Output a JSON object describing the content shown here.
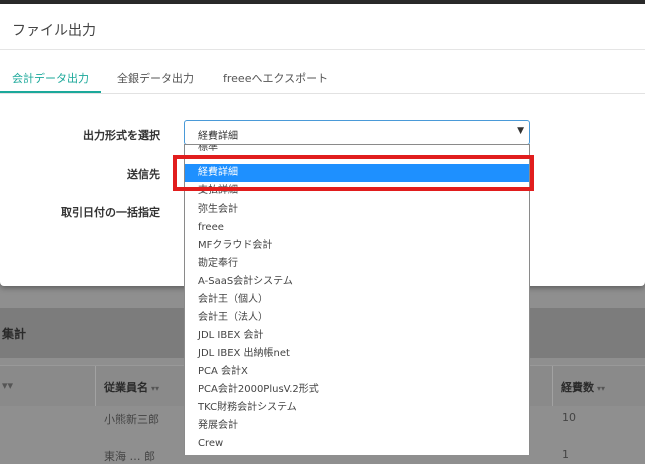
{
  "modal": {
    "title": "ファイル出力",
    "tabs": [
      {
        "label": "会計データ出力"
      },
      {
        "label": "全銀データ出力"
      },
      {
        "label": "freeeへエクスポート"
      }
    ],
    "form": {
      "format_label": "出力形式を選択",
      "format_value": "経費詳細",
      "send_to_label": "送信先",
      "date_label": "取引日付の一括指定"
    },
    "dropdown_options": [
      "標準",
      "経費詳細",
      "支払詳細",
      "弥生会計",
      "freee",
      "MFクラウド会計",
      "勘定奉行",
      "A-SaaS会計システム",
      "会計王（個人）",
      "会計王（法人）",
      "JDL IBEX 会計",
      "JDL IBEX 出納帳net",
      "PCA 会計X",
      "PCA会計2000PlusV.2形式",
      "TKC財務会計システム",
      "発展会計",
      "Crew"
    ],
    "selected_option": "経費詳細"
  },
  "background": {
    "section_title": "集計",
    "columns": [
      "従業員名",
      "経費数"
    ],
    "rows": [
      {
        "name": "小熊新三郎",
        "count": "10"
      },
      {
        "name": "東海 … 郎",
        "count": "1"
      }
    ]
  },
  "colors": {
    "accent": "#1ba89a",
    "selection": "#1e90ff",
    "highlight_box": "#e11d1d"
  }
}
